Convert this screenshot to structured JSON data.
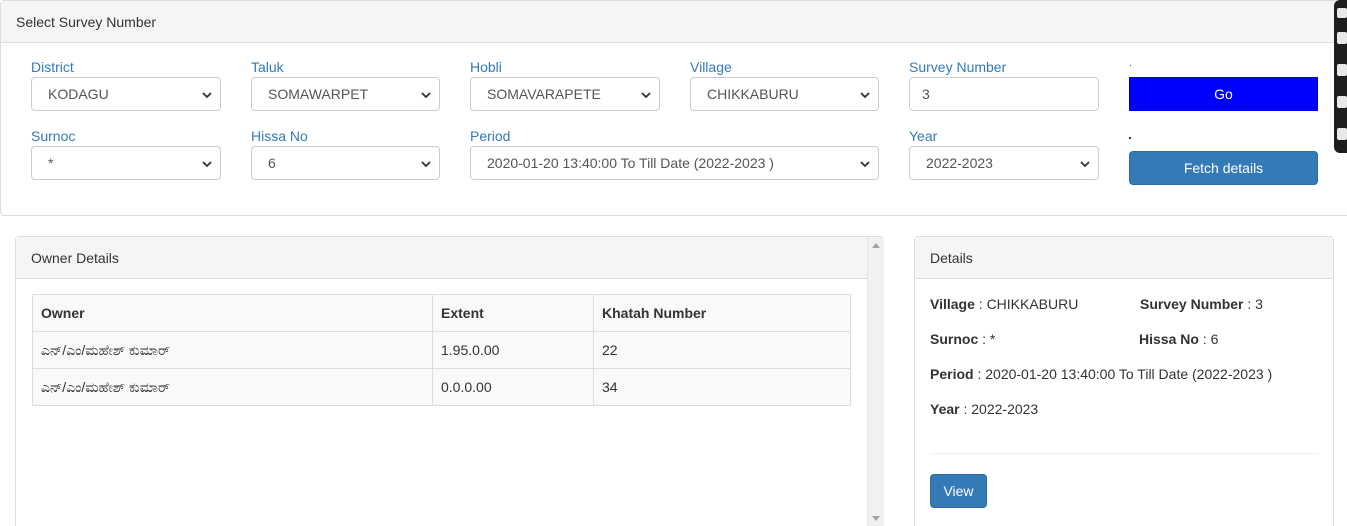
{
  "survey_panel": {
    "title": "Select Survey Number",
    "fields": {
      "district": {
        "label": "District",
        "value": "KODAGU"
      },
      "taluk": {
        "label": "Taluk",
        "value": "SOMAWARPET"
      },
      "hobli": {
        "label": "Hobli",
        "value": "SOMAVARAPETE"
      },
      "village": {
        "label": "Village",
        "value": "CHIKKABURU"
      },
      "survey_number": {
        "label": "Survey Number",
        "value": "3"
      },
      "surnoc": {
        "label": "Surnoc",
        "value": "*"
      },
      "hissa_no": {
        "label": "Hissa No",
        "value": "6"
      },
      "period": {
        "label": "Period",
        "value": "2020-01-20 13:40:00 To Till Date (2022-2023 )"
      },
      "year": {
        "label": "Year",
        "value": "2022-2023"
      }
    },
    "dot_label": ".",
    "go_label": "Go",
    "fetch_label": "Fetch details"
  },
  "owner_panel": {
    "title": "Owner Details",
    "columns": [
      "Owner",
      "Extent",
      "Khatah Number"
    ],
    "rows": [
      {
        "owner": "ಎನ್/ಎಂ/ಮಹೇಶ್ ಕುಮಾರ್",
        "extent": "1.95.0.00",
        "khatah": "22"
      },
      {
        "owner": "ಎನ್/ಎಂ/ಮಹೇಶ್ ಕುಮಾರ್",
        "extent": "0.0.0.00",
        "khatah": "34"
      }
    ]
  },
  "details_panel": {
    "title": "Details",
    "village_label": "Village",
    "village_value": "CHIKKABURU",
    "survey_label": "Survey Number",
    "survey_value": "3",
    "surnoc_label": "Surnoc",
    "surnoc_value": "*",
    "hissa_label": "Hissa No",
    "hissa_value": "6",
    "period_label": "Period",
    "period_value": "2020-01-20 13:40:00 To Till Date (2022-2023 )",
    "year_label": "Year",
    "year_value": "2022-2023",
    "view_label": "View"
  },
  "colors": {
    "label_blue": "#337ab7",
    "go_button": "#0000ff",
    "primary_button": "#337ab7"
  }
}
